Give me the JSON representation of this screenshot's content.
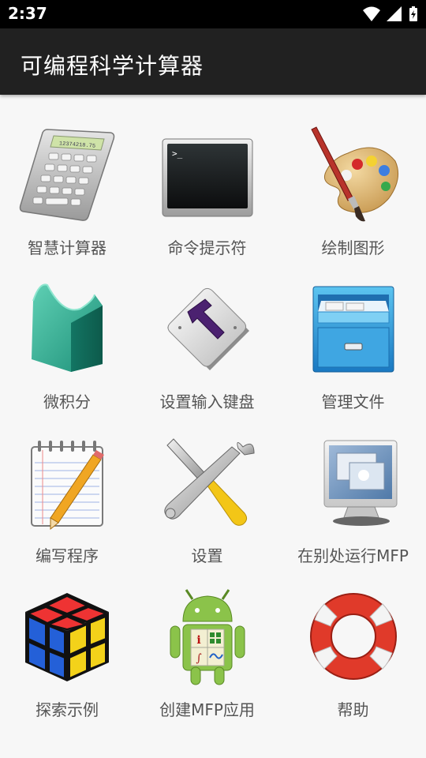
{
  "status": {
    "time": "2:37"
  },
  "app": {
    "title": "可编程科学计算器"
  },
  "menu": [
    {
      "label": "智慧计算器",
      "icon": "calculator-icon"
    },
    {
      "label": "命令提示符",
      "icon": "terminal-icon"
    },
    {
      "label": "绘制图形",
      "icon": "palette-icon"
    },
    {
      "label": "微积分",
      "icon": "calculus-shape-icon"
    },
    {
      "label": "设置输入键盘",
      "icon": "keyboard-hammer-icon"
    },
    {
      "label": "管理文件",
      "icon": "file-cabinet-icon"
    },
    {
      "label": "编写程序",
      "icon": "notepad-pencil-icon"
    },
    {
      "label": "设置",
      "icon": "wrench-screwdriver-icon"
    },
    {
      "label": "在别处运行MFP",
      "icon": "monitor-icon"
    },
    {
      "label": "探索示例",
      "icon": "rubik-cube-icon"
    },
    {
      "label": "创建MFP应用",
      "icon": "android-app-icon"
    },
    {
      "label": "帮助",
      "icon": "lifebuoy-icon"
    }
  ],
  "calculator_display": "12374218.75",
  "colors": {
    "status_bar": "#000000",
    "app_bar": "#212121",
    "background": "#f7f7f7"
  }
}
